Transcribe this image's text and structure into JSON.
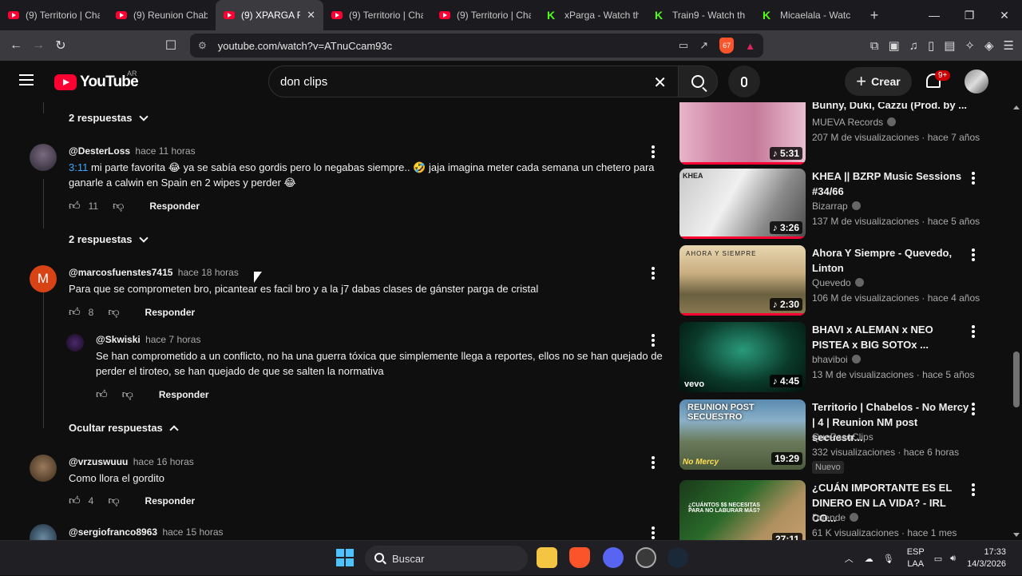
{
  "browser": {
    "tabs": [
      {
        "title": "(9) Territorio | Cha",
        "icon": "youtube-icon",
        "active": false
      },
      {
        "title": "(9) Reunion Chab",
        "icon": "youtube-icon",
        "active": false
      },
      {
        "title": "(9) XPARGA R",
        "icon": "youtube-icon",
        "active": true
      },
      {
        "title": "(9) Territorio | Cha",
        "icon": "youtube-icon",
        "active": false
      },
      {
        "title": "(9) Territorio | Cha",
        "icon": "youtube-icon",
        "active": false
      },
      {
        "title": "xParga - Watch th",
        "icon": "kick-icon",
        "active": false
      },
      {
        "title": "Train9 - Watch th",
        "icon": "kick-icon",
        "active": false
      },
      {
        "title": "Micaelala - Watc",
        "icon": "kick-icon",
        "active": false
      }
    ],
    "url": "youtube.com/watch?v=ATnuCcam93c",
    "brave_badge": "67"
  },
  "youtube": {
    "logo_text": "YouTube",
    "country_code": "AR",
    "search_value": "don clips",
    "create_label": "Crear",
    "notif_count": "9+"
  },
  "comments": {
    "top_replies_label": "2 respuestas",
    "items": [
      {
        "author": "@DesterLoss",
        "time": "hace 11 horas",
        "timestamp_link": "3:11",
        "text": " mi parte favorita 😂  ya se sabía eso gordis pero lo negabas siempre.. 🤣  jaja imagina meter cada semana un chetero para ganarle a calwin en Spain en 2 wipes y perder 😂",
        "likes": "11",
        "reply_label": "Responder",
        "replies_label": "2 respuestas"
      },
      {
        "author": "@marcosfuenstes7415",
        "time": "hace 18 horas",
        "avatar_letter": "M",
        "text": "Para que se comprometen bro, picantear es facil bro y a la j7 dabas clases de gánster parga de cristal",
        "likes": "8",
        "reply_label": "Responder"
      },
      {
        "author": "@Skwiski",
        "time": "hace 7 horas",
        "text": "Se han comprometido a un conflicto, no ha una guerra tóxica que simplemente llega a reportes, ellos no se han quejado de perder el tiroteo, se han quejado de que se salten la normativa",
        "likes": "",
        "reply_label": "Responder"
      },
      {
        "hide_label": "Ocultar respuestas"
      },
      {
        "author": "@vrzuswuuu",
        "time": "hace 16 horas",
        "text": "Como llora el gordito",
        "likes": "4",
        "reply_label": "Responder"
      },
      {
        "author": "@sergiofranco8963",
        "time": "hace 15 horas"
      }
    ]
  },
  "related": [
    {
      "title": "Bunny, Duki, Cazzu (Prod. by ...",
      "channel": "MUEVA Records",
      "meta": "207 M de visualizaciones · hace 7 años",
      "duration": "5:31"
    },
    {
      "title": "KHEA || BZRP Music Sessions #34/66",
      "channel": "Bizarrap",
      "meta": "137 M de visualizaciones · hace 5 años",
      "duration": "3:26",
      "thumb_text": "KHEA"
    },
    {
      "title": "Ahora Y Siempre - Quevedo, Linton",
      "channel": "Quevedo",
      "meta": "106 M de visualizaciones · hace 4 años",
      "duration": "2:30",
      "thumb_text": "AHORA Y SIEMPRE"
    },
    {
      "title": "BHAVI x ALEMAN x NEO PISTEA x BIG SOTOx ...",
      "channel": "bhaviboi",
      "meta": "13 M de visualizaciones · hace 5 años",
      "duration": "4:45",
      "thumb_text": "vevo"
    },
    {
      "title": "Territorio | Chabelos - No Mercy | 4 | Reunion NM post secuestr...",
      "channel": "QuePasoClips",
      "meta": "332 visualizaciones · hace 6 horas",
      "duration": "19:29",
      "badge": "Nuevo",
      "thumb_text": "REUNION POST SECUESTRO"
    },
    {
      "title": "¿CUÁN IMPORTANTE ES EL DINERO EN LA VIDA? - IRL CO...",
      "channel": "Duende",
      "meta": "61 K visualizaciones · hace 1 mes",
      "duration": "27:11",
      "thumb_text": "¿CUÁNTOS $$ NECESITAS PARA NO LABURAR MÁS?"
    }
  ],
  "taskbar": {
    "search_placeholder": "Buscar",
    "lang_top": "ESP",
    "lang_bottom": "LAA",
    "time": "17:33",
    "date": "14/3/2026"
  }
}
